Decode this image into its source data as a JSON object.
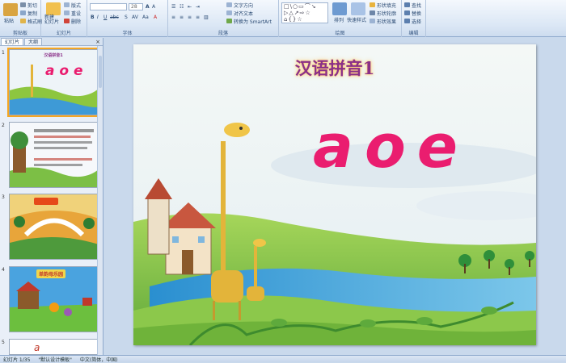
{
  "ribbon": {
    "clipboard": {
      "label": "剪贴板",
      "paste": "粘贴",
      "cut": "剪切",
      "copy": "复制",
      "format_painter": "格式刷"
    },
    "slides": {
      "label": "幻灯片",
      "new_slide": "新建\n幻灯片",
      "layout": "版式",
      "reset": "重设",
      "delete": "删除"
    },
    "font": {
      "label": "字体",
      "font_size": "28"
    },
    "paragraph": {
      "label": "段落",
      "text_direction": "文字方向",
      "align_text": "对齐文本",
      "smartart": "转换为 SmartArt"
    },
    "drawing": {
      "label": "绘图",
      "arrange": "排列",
      "quick_styles": "快速样式",
      "shape_fill": "形状填充",
      "shape_outline": "形状轮廓",
      "shape_effects": "形状效果"
    },
    "editing": {
      "label": "编辑",
      "find": "查找",
      "replace": "替换",
      "select": "选择"
    }
  },
  "pane": {
    "tabs": [
      "幻灯片",
      "大纲"
    ],
    "close": "×",
    "thumbnails": [
      {
        "num": "1",
        "title": "汉语拼音1",
        "letters": "a o e"
      },
      {
        "num": "2"
      },
      {
        "num": "3"
      },
      {
        "num": "4",
        "title": "单韵母乐园"
      },
      {
        "num": "5"
      }
    ]
  },
  "slide": {
    "title": "汉语拼音1",
    "letters": [
      "a",
      "o",
      "e"
    ]
  },
  "status": {
    "slide_info": "幻灯片 1/35",
    "theme": "\"默认设计模板\"",
    "language": "中文(简体，中国)"
  },
  "colors": {
    "title": "#8a2f88",
    "letters": "#ea1d6f",
    "ribbon_bg": "#dbe7f5",
    "selection": "#f5a623"
  }
}
